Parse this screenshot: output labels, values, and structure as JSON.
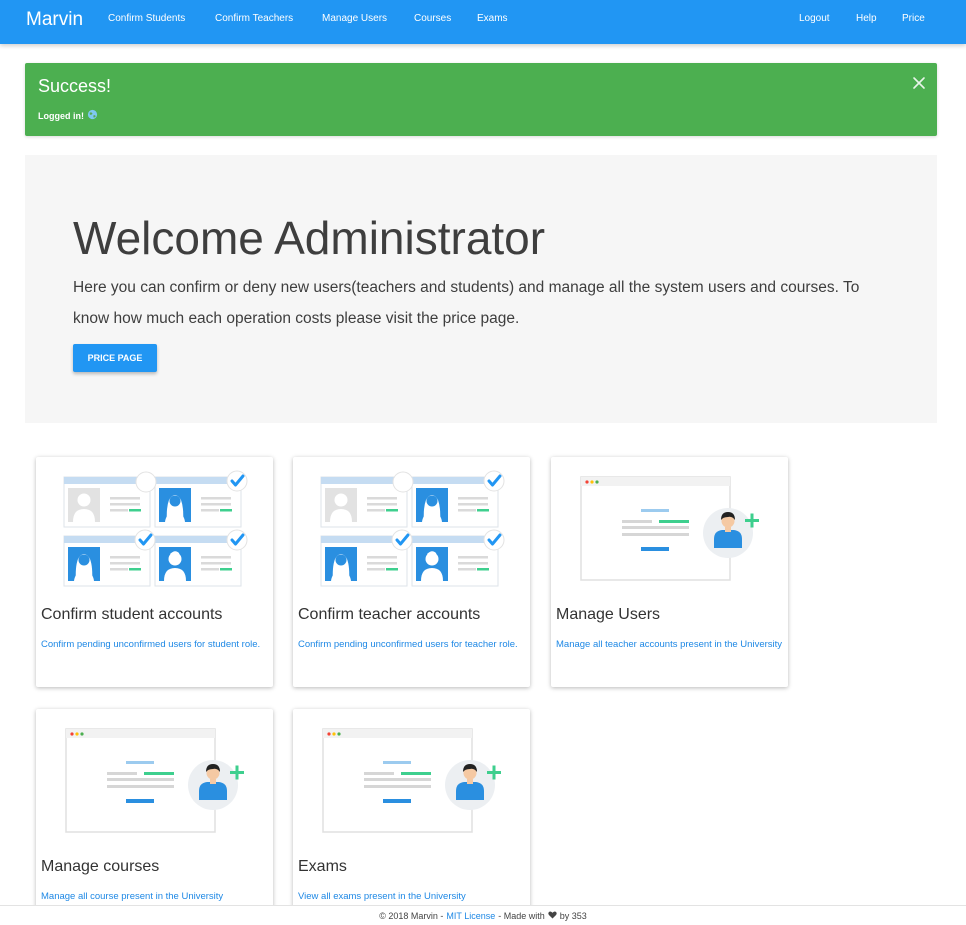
{
  "navbar": {
    "brand": "Marvin",
    "links": [
      "Confirm Students",
      "Confirm Teachers",
      "Manage Users",
      "Courses",
      "Exams"
    ],
    "right_links": [
      "Logout",
      "Help",
      "Price"
    ]
  },
  "alert": {
    "title": "Success!",
    "message": "Logged in!",
    "close_icon": "close-icon",
    "emoji_icon": "globe-icon"
  },
  "jumbotron": {
    "title": "Welcome Administrator",
    "text": "Here you can confirm or deny new users(teachers and students) and manage all the system users and courses. To know how much each operation costs please visit the price page.",
    "button": "PRICE PAGE"
  },
  "cards": [
    {
      "title": "Confirm student accounts",
      "desc": "Confirm pending unconfirmed users for student role.",
      "icon": "student-accounts-illustration"
    },
    {
      "title": "Confirm teacher accounts",
      "desc": "Confirm pending unconfirmed users for teacher role.",
      "icon": "teacher-accounts-illustration"
    },
    {
      "title": "Manage Users",
      "desc": "Manage all teacher accounts present in the University",
      "icon": "add-user-illustration"
    },
    {
      "title": "Manage courses",
      "desc": "Manage all course present in the University",
      "icon": "add-user-illustration"
    },
    {
      "title": "Exams",
      "desc": "View all exams present in the University",
      "icon": "add-user-illustration"
    }
  ],
  "footer": {
    "prefix": "© 2018 Marvin -",
    "license": "MIT License",
    "made_with": "- Made with",
    "by": "by 353",
    "heart_icon": "heart-icon"
  },
  "colors": {
    "primary": "#2196f3",
    "success": "#4caf50",
    "jumbotron_bg": "#f6f6f6",
    "link": "#1e88e5",
    "accent_green": "#3ecf8e"
  }
}
